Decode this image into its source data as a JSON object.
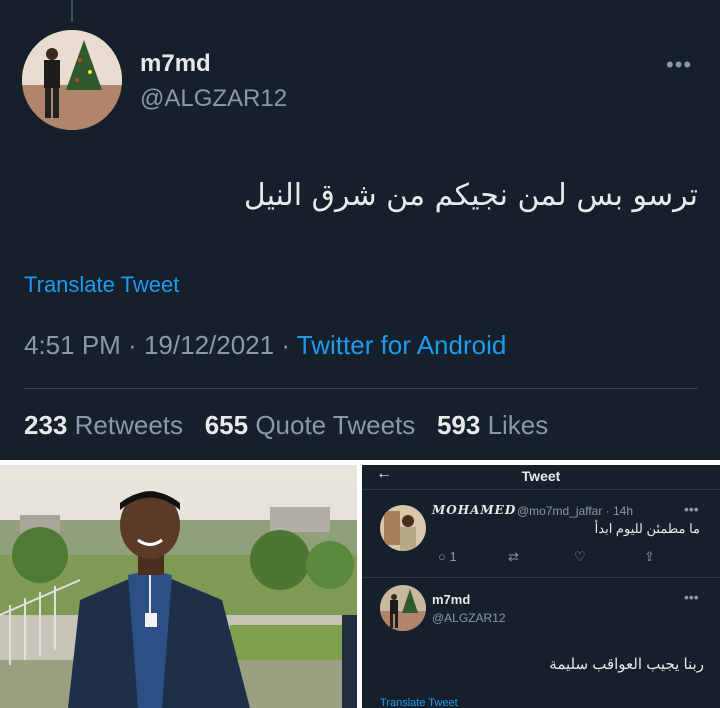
{
  "tweet": {
    "name": "m7md",
    "handle": "@ALGZAR12",
    "more_icon": "more-horizontal-icon",
    "text": "ترسو بس لمن نجيكم من شرق النيل",
    "translate_label": "Translate Tweet",
    "time": "4:51 PM",
    "date": "19/12/2021",
    "separator": "·",
    "source": "Twitter for Android",
    "stats": {
      "retweets_count": "233",
      "retweets_label": "Retweets",
      "quotes_count": "655",
      "quotes_label": "Quote Tweets",
      "likes_count": "593",
      "likes_label": "Likes"
    }
  },
  "screenshot": {
    "back_icon": "←",
    "title": "Tweet",
    "reply": {
      "name": "𝑴𝑶𝑯𝑨𝑴𝑬𝑫",
      "handle_time": "@mo7md_jaffar · 14h",
      "text": "ما مطمئن لليوم ابدأ",
      "reply_count": "1",
      "icons": {
        "reply": "💬",
        "retweet": "⇄",
        "like": "♡",
        "share": "⇪"
      }
    },
    "main": {
      "name": "m7md",
      "handle": "@ALGZAR12",
      "text": "ربنا يجيب العواقب سليمة",
      "translate_label": "Translate Tweet"
    }
  },
  "colors": {
    "background": "#15202b",
    "accent": "#1d9bf0",
    "muted": "#8b98a5",
    "text": "#e7e9ea"
  }
}
